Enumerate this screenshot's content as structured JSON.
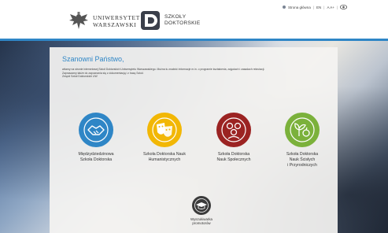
{
  "header": {
    "university_line1": "UNIWERSYTET",
    "university_line2": "WARSZAWSKI",
    "school_line1": "SZKOŁY",
    "school_line2": "DOKTORSKIE"
  },
  "topnav": {
    "home_label": "Strona główna",
    "lang_label": "EN",
    "font_size_label": "A A+",
    "separator": "|"
  },
  "panel": {
    "title": "Szanowni Państwo,",
    "intro_lines": [
      "witamy na stronie internetowej Szkół Doktorskich Uniwersytetu Warszawskiego. Można tu znaleźć informacje m.in. o programie kształcenia, zajęciach i zasadach rekrutacji.",
      "Zapraszamy także do zapoznania się z dokumentacją i z bazą Szkół.",
      "Zespół Szkół Doktorskich UW"
    ]
  },
  "schools": [
    {
      "line1": "Międzydziedzinowa",
      "line2": "Szkoła Doktorska",
      "line3": "",
      "icon": "handshake-icon",
      "color": "#2f86c6"
    },
    {
      "line1": "Szkoła Doktorska Nauk",
      "line2": "Humanistycznych",
      "line3": "",
      "icon": "theater-masks-icon",
      "color": "#f2b705"
    },
    {
      "line1": "Szkoła Doktorska",
      "line2": "Nauk Społecznych",
      "line3": "",
      "icon": "people-group-icon",
      "color": "#9b2322"
    },
    {
      "line1": "Szkoła Doktorska",
      "line2": "Nauk Ścisłych",
      "line3": "i Przyrodniczych",
      "icon": "plant-apple-icon",
      "color": "#7bb13b"
    }
  ],
  "search_tool": {
    "line1": "Wyszukiwarka",
    "line2": "promotorów",
    "icon": "graduation-cap-icon"
  },
  "colors": {
    "accent_blue": "#2f86c6"
  }
}
